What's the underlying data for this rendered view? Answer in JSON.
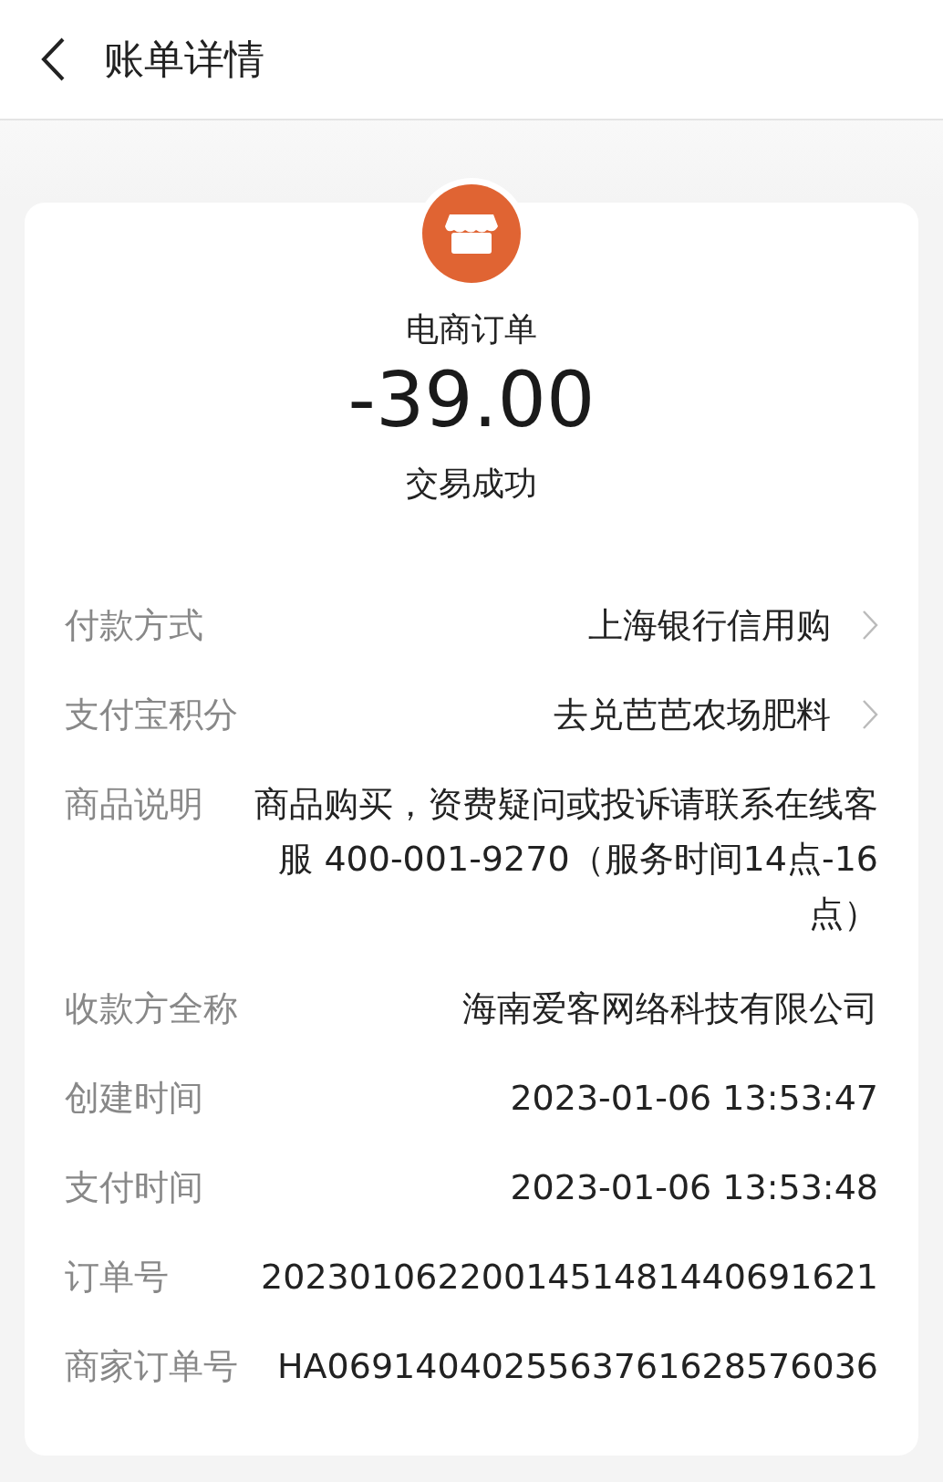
{
  "header": {
    "title": "账单详情"
  },
  "summary": {
    "category": "电商订单",
    "amount": "-39.00",
    "status": "交易成功"
  },
  "rows": [
    {
      "label": "付款方式",
      "value": "上海银行信用购",
      "link": true
    },
    {
      "label": "支付宝积分",
      "value": "去兑芭芭农场肥料",
      "link": true
    },
    {
      "label": "商品说明",
      "value": "商品购买，资费疑问或投诉请联系在线客服 400-001-9270（服务时间14点-16点）",
      "link": false
    },
    {
      "label": "收款方全称",
      "value": "海南爱客网络科技有限公司",
      "link": false
    },
    {
      "label": "创建时间",
      "value": "2023-01-06 13:53:47",
      "link": false
    },
    {
      "label": "支付时间",
      "value": "2023-01-06 13:53:48",
      "link": false
    },
    {
      "label": "订单号",
      "value": "2023010622001451481440691621",
      "link": false
    },
    {
      "label": "商家订单号",
      "value": "HA0691404025563761628576036",
      "link": false
    }
  ]
}
